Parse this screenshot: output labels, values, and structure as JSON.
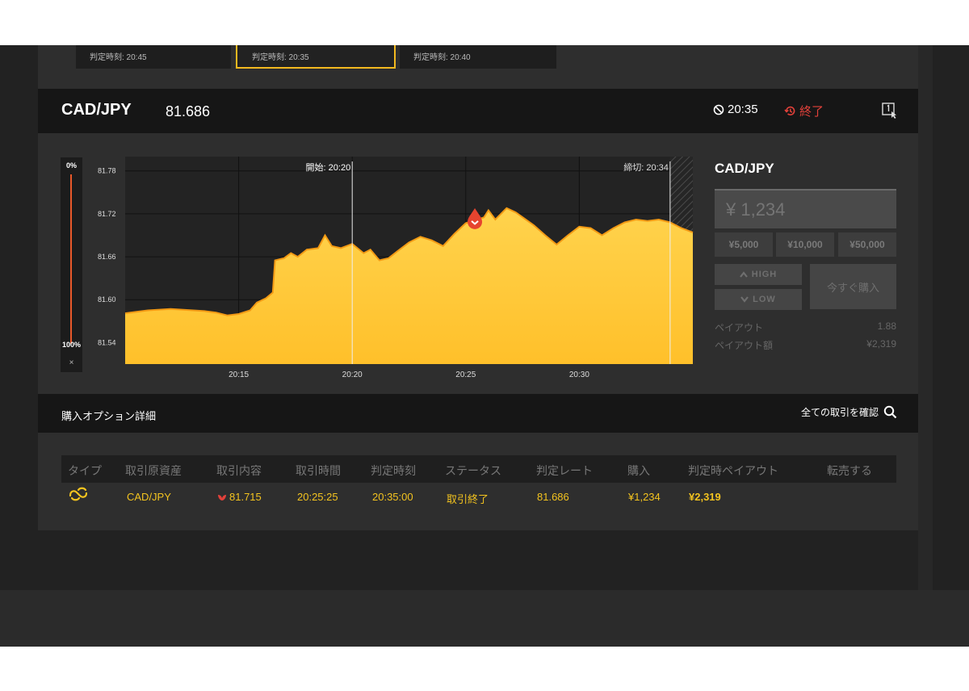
{
  "option_cards": [
    {
      "label": "判定時刻: 20:45"
    },
    {
      "label": "判定時刻: 20:35",
      "active": true
    },
    {
      "label": "判定時刻: 20:40"
    }
  ],
  "header": {
    "pair": "CAD/JPY",
    "rate": "81.686",
    "expiry": "20:35",
    "status": "終了"
  },
  "gauge": {
    "top": "0%",
    "bottom": "100%",
    "close": "×"
  },
  "chart_data": {
    "type": "area",
    "x_tick_labels": [
      "20:15",
      "20:20",
      "20:25",
      "20:30"
    ],
    "y_tick_labels": [
      "81.78",
      "81.72",
      "81.66",
      "81.60",
      "81.54"
    ],
    "ylim": [
      81.51,
      81.8
    ],
    "x_range_minutes": [
      0,
      25
    ],
    "x_ticks_minutes": [
      5,
      10,
      15,
      20
    ],
    "y_ticks": [
      81.78,
      81.72,
      81.66,
      81.6,
      81.54
    ],
    "start_label": "開始: 20:20",
    "start_minute": 10,
    "deadline_label": "締切: 20:34",
    "deadline_minute": 24,
    "entry_minute": 15.4,
    "entry_value": 81.711,
    "series": [
      {
        "points": [
          [
            0,
            81.581
          ],
          [
            0.5,
            81.583
          ],
          [
            1,
            81.585
          ],
          [
            1.5,
            81.586
          ],
          [
            2,
            81.587
          ],
          [
            2.5,
            81.586
          ],
          [
            3,
            81.585
          ],
          [
            3.5,
            81.584
          ],
          [
            4,
            81.582
          ],
          [
            4.5,
            81.578
          ],
          [
            5,
            81.58
          ],
          [
            5.5,
            81.585
          ],
          [
            5.8,
            81.596
          ],
          [
            6.2,
            81.602
          ],
          [
            6.5,
            81.61
          ],
          [
            6.6,
            81.655
          ],
          [
            7,
            81.658
          ],
          [
            7.3,
            81.665
          ],
          [
            7.6,
            81.66
          ],
          [
            8,
            81.67
          ],
          [
            8.5,
            81.672
          ],
          [
            8.8,
            81.69
          ],
          [
            9.1,
            81.675
          ],
          [
            9.5,
            81.672
          ],
          [
            10,
            81.678
          ],
          [
            10.5,
            81.665
          ],
          [
            10.8,
            81.67
          ],
          [
            11.2,
            81.655
          ],
          [
            11.6,
            81.658
          ],
          [
            12,
            81.668
          ],
          [
            12.5,
            81.68
          ],
          [
            13,
            81.688
          ],
          [
            13.5,
            81.683
          ],
          [
            14,
            81.675
          ],
          [
            14.5,
            81.692
          ],
          [
            15,
            81.707
          ],
          [
            15.4,
            81.711
          ],
          [
            15.8,
            81.715
          ],
          [
            16,
            81.725
          ],
          [
            16.3,
            81.712
          ],
          [
            16.8,
            81.728
          ],
          [
            17.2,
            81.722
          ],
          [
            17.6,
            81.713
          ],
          [
            18,
            81.704
          ],
          [
            18.5,
            81.69
          ],
          [
            19,
            81.677
          ],
          [
            19.5,
            81.69
          ],
          [
            20,
            81.702
          ],
          [
            20.5,
            81.7
          ],
          [
            21,
            81.69
          ],
          [
            21.5,
            81.7
          ],
          [
            22,
            81.708
          ],
          [
            22.5,
            81.712
          ],
          [
            23,
            81.71
          ],
          [
            23.5,
            81.712
          ],
          [
            24,
            81.708
          ],
          [
            24.5,
            81.7
          ],
          [
            25,
            81.694
          ]
        ]
      }
    ]
  },
  "trade": {
    "title": "CAD/JPY",
    "amount_placeholder": "¥ 1,234",
    "presets": [
      "¥5,000",
      "¥10,000",
      "¥50,000"
    ],
    "high_label": "HIGH",
    "low_label": "LOW",
    "buy_now_label": "今すぐ購入",
    "payout_label": "ペイアウト",
    "payout_value": "1.88",
    "payout_amount_label": "ペイアウト額",
    "payout_amount_value": "¥2,319"
  },
  "details": {
    "title": "購入オプション詳細",
    "all_trades_label": "全ての取引を確認",
    "columns": [
      "タイプ",
      "取引原資産",
      "取引内容",
      "取引時間",
      "判定時刻",
      "ステータス",
      "判定レート",
      "購入",
      "判定時ペイアウト",
      "転売する"
    ],
    "row": {
      "asset": "CAD/JPY",
      "direction_rate": "81.715",
      "trade_time": "20:25:25",
      "expiry_time": "20:35:00",
      "status": "取引終了",
      "expiry_rate": "81.686",
      "purchase": "¥1,234",
      "payout": "¥2,319"
    }
  },
  "colors": {
    "accent": "#f3b91f",
    "down": "#e2413a",
    "chart_fill": "#ffc83a",
    "chart_line": "#f39a14"
  }
}
